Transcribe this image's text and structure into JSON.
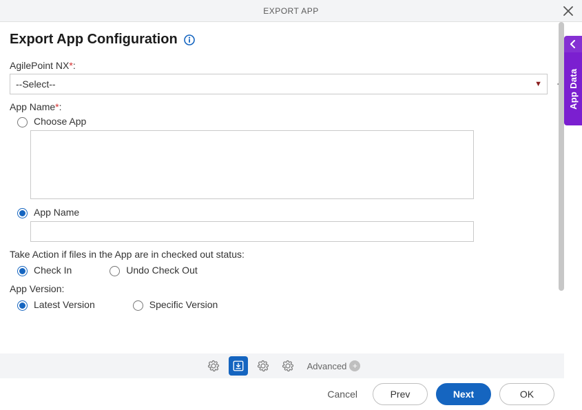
{
  "header": {
    "title": "EXPORT APP"
  },
  "page": {
    "title": "Export App Configuration"
  },
  "fields": {
    "agilepoint": {
      "label": "AgilePoint NX",
      "select_placeholder": "--Select--"
    },
    "appname": {
      "label": "App Name",
      "choose_label": "Choose App",
      "name_label": "App Name"
    },
    "take_action": {
      "label": "Take Action if files in the App are in checked out status:",
      "checkin_label": "Check In",
      "undo_label": "Undo Check Out"
    },
    "version": {
      "label": "App Version:",
      "latest_label": "Latest Version",
      "specific_label": "Specific Version"
    }
  },
  "toolbar": {
    "advanced_label": "Advanced"
  },
  "footer": {
    "cancel_label": "Cancel",
    "prev_label": "Prev",
    "next_label": "Next",
    "ok_label": "OK"
  },
  "sidetab": {
    "label": "App Data"
  }
}
